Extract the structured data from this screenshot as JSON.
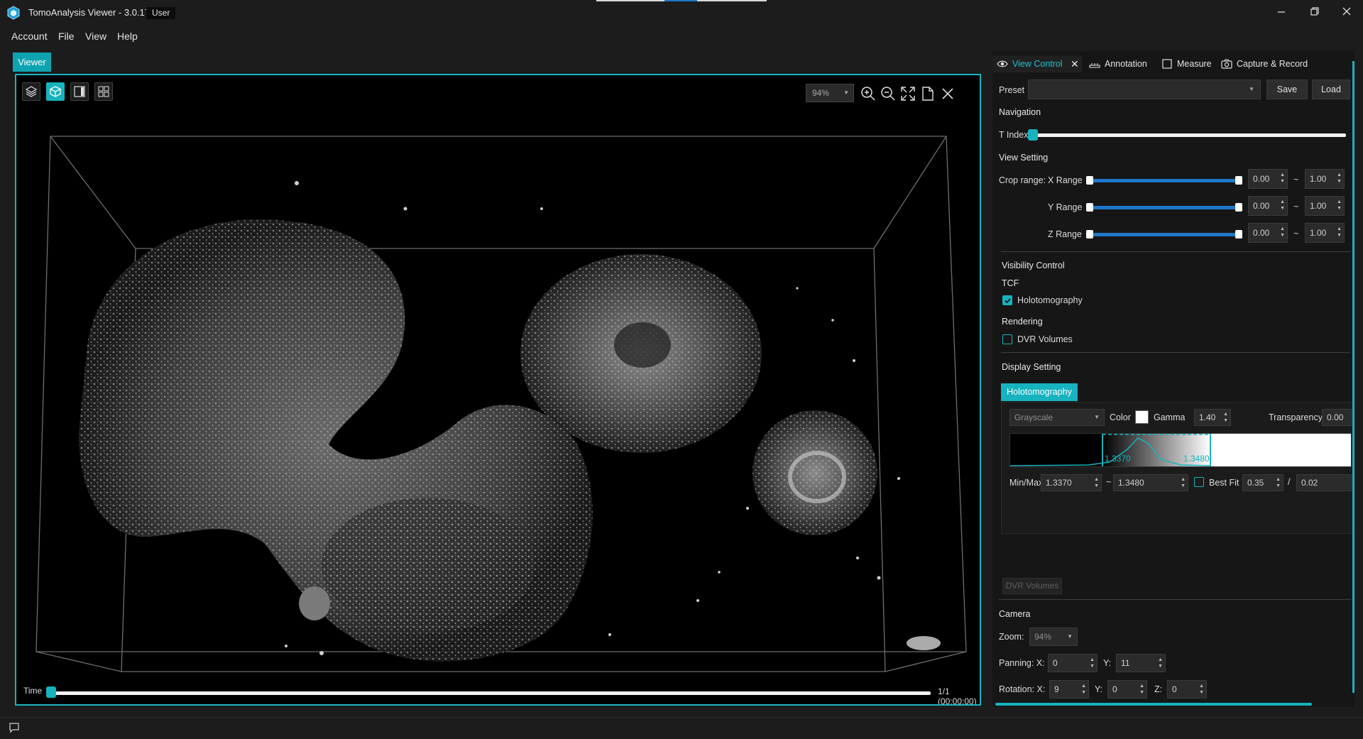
{
  "app": {
    "title": "TomoAnalysis Viewer - 3.0.17",
    "user_badge": "User",
    "logo_icon": "hexagon-logo-icon"
  },
  "window_controls": [
    "minimize-icon",
    "restore-icon",
    "close-icon"
  ],
  "menu": [
    "Account",
    "File",
    "View",
    "Help"
  ],
  "viewer_tab": "Viewer",
  "viewport": {
    "zoom": "94%",
    "left_tools": [
      "layers-icon",
      "cube-3d-icon",
      "slice-layout-icon",
      "grid-layout-icon"
    ],
    "active_left_tool": "cube-3d-icon",
    "right_tools": [
      "zoom-in-icon",
      "zoom-out-icon",
      "fit-to-screen-icon",
      "document-icon",
      "close-icon"
    ],
    "time_label": "Time",
    "time_readout": "1/1 (00:00:00)",
    "time_progress": 0.0
  },
  "panel": {
    "tabs": [
      "View Control",
      "Annotation",
      "Measure",
      "Capture & Record"
    ],
    "tab_icons": [
      "eye-icon",
      "ruler-icon",
      "measure-icon",
      "camera-icon"
    ],
    "active_tab": "View Control",
    "preset_label": "Preset",
    "preset_value": "",
    "save_button": "Save",
    "load_button": "Load",
    "navigation": "Navigation",
    "t_index": "T Index",
    "t_index_value": 0.0,
    "view_setting": "View Setting",
    "crop_label": "Crop range:",
    "ranges": [
      {
        "label": "X Range",
        "min": "0.00",
        "max": "1.00"
      },
      {
        "label": "Y Range",
        "min": "0.00",
        "max": "1.00"
      },
      {
        "label": "Z Range",
        "min": "0.00",
        "max": "1.00"
      }
    ],
    "tilde": "~",
    "visibility_control": "Visibility Control",
    "tcf": "TCF",
    "holotomography_check": "Holotomography",
    "holotomography_checked": true,
    "rendering": "Rendering",
    "dvr_check": "DVR Volumes",
    "dvr_checked": false,
    "display_setting": "Display Setting",
    "holo_tab": "Holotomography",
    "colormap": "Grayscale",
    "color_label": "Color",
    "color_value": "#ffffff",
    "gamma_label": "Gamma",
    "gamma_value": "1.40",
    "transparency_label": "Transparency",
    "transparency_value": "0.00",
    "hist_min_label": "1.3370",
    "hist_max_label": "1.3480",
    "minmax_label": "Min/Max",
    "min_value": "1.3370",
    "max_value": "1.3480",
    "best_fit": "Best Fit",
    "best_fit_checked": false,
    "best_fit_value": "0.35",
    "slash": "/",
    "best_fit_value2": "0.02",
    "dvr_tab": "DVR Volumes",
    "camera": "Camera",
    "zoom_label": "Zoom:",
    "zoom_value": "94%",
    "panning_label": "Panning: X:",
    "panning_x": "0",
    "panning_y_label": "Y:",
    "panning_y": "11",
    "rotation_label": "Rotation: X:",
    "rotation_x": "9",
    "rotation_y_label": "Y:",
    "rotation_y": "0",
    "rotation_z_label": "Z:",
    "rotation_z": "0"
  },
  "status_icon": "chat-icon",
  "colors": {
    "accent": "#17b3bf",
    "slider_blue": "#1f77c9",
    "background": "#1c1c1c",
    "panel": "#161616"
  }
}
